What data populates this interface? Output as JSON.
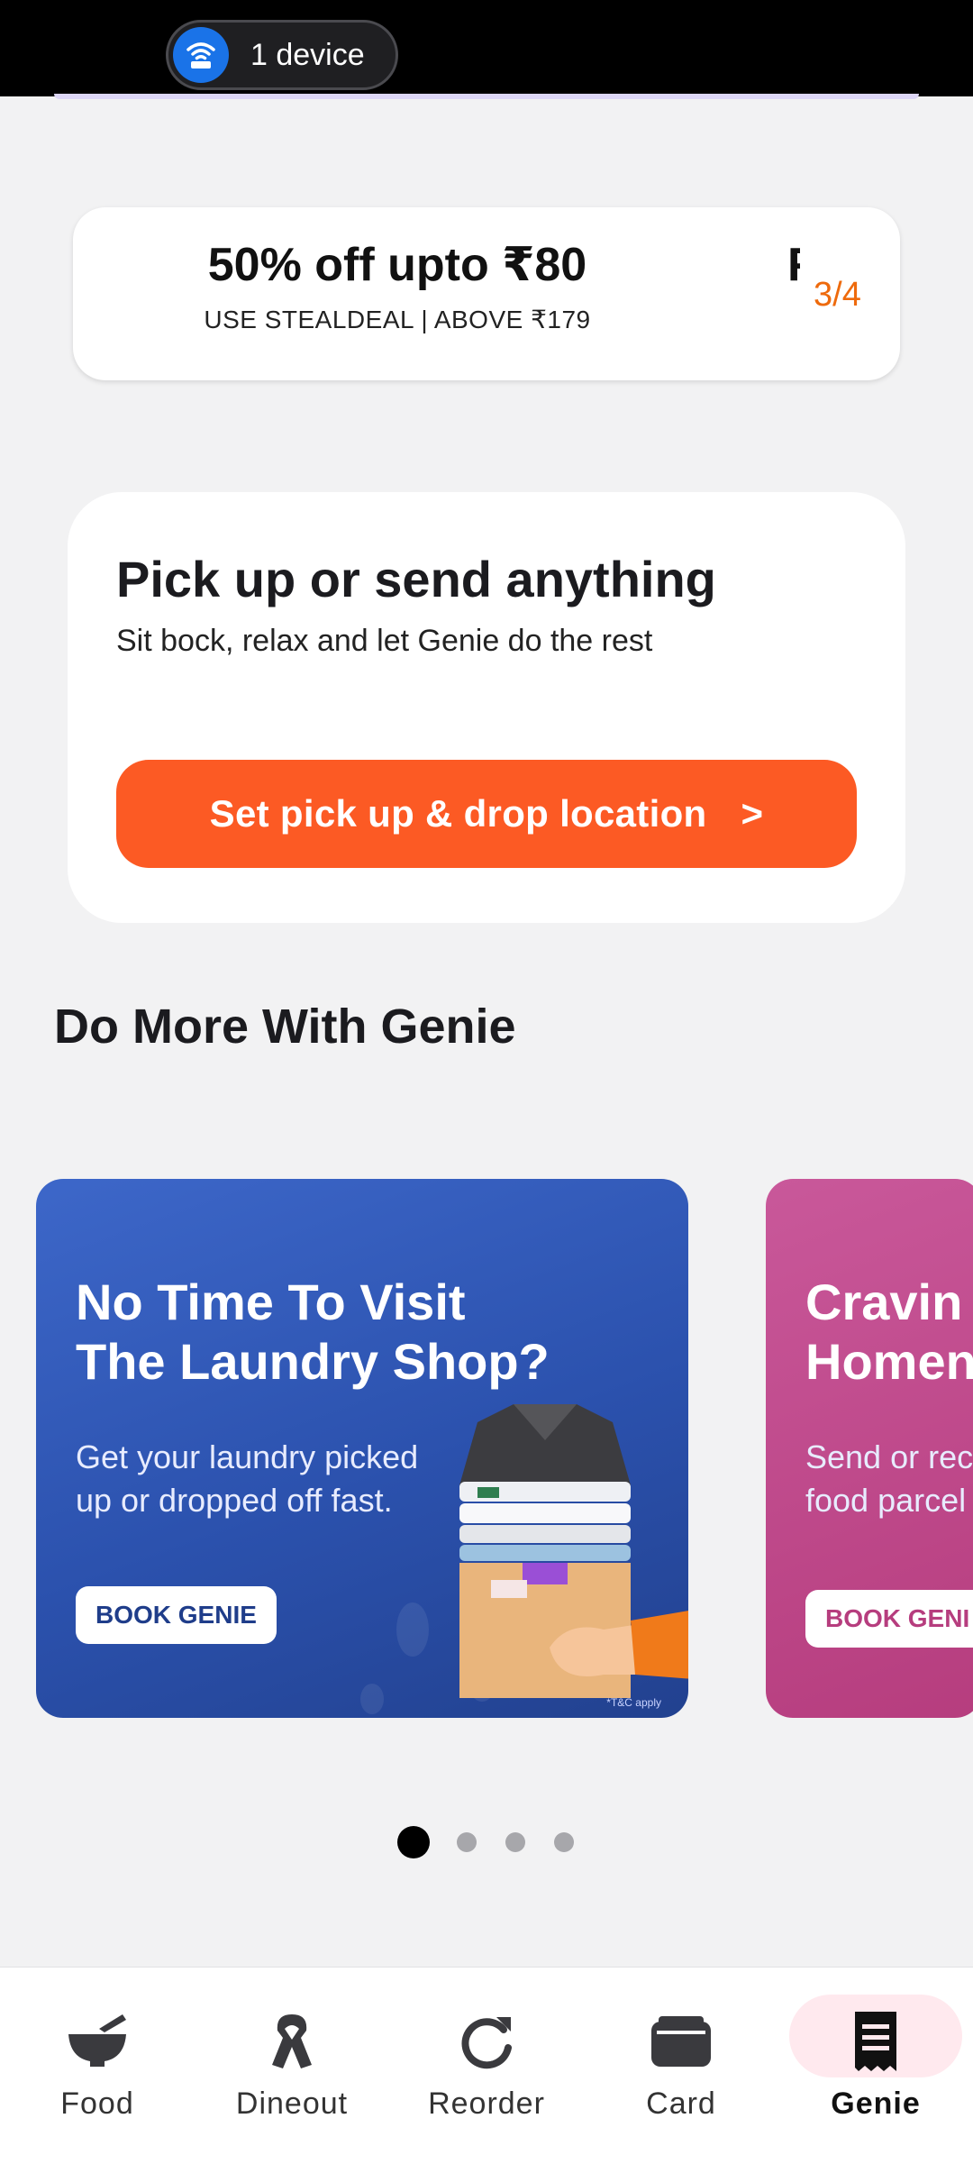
{
  "status_bar": {
    "device_label": "1 device"
  },
  "offer": {
    "title": "50% off upto ₹80",
    "subtitle": "USE STEALDEAL | ABOVE ₹179",
    "next_peek": "F",
    "counter": "3/4"
  },
  "genie_card": {
    "title": "Pick up or send anything",
    "subtitle": "Sit bock, relax and let Genie do the rest",
    "button_label": "Set pick up & drop location",
    "button_chevron": ">"
  },
  "section_title": "Do More With Genie",
  "banners": [
    {
      "heading_line1": "No Time To Visit",
      "heading_line2": "The Laundry Shop?",
      "desc_line1": "Get your laundry picked",
      "desc_line2": "up or dropped off fast.",
      "button": "BOOK GENIE",
      "note": "*T&C apply"
    },
    {
      "heading_line1": "Cravin",
      "heading_line2": "Homen",
      "desc_line1": "Send or rec",
      "desc_line2": "food parcel",
      "button": "BOOK GENI"
    }
  ],
  "carousel": {
    "total": 4,
    "active": 0
  },
  "bottom_nav": [
    {
      "label": "Food",
      "icon": "food-bowl-icon"
    },
    {
      "label": "Dineout",
      "icon": "dineout-ribbon-icon"
    },
    {
      "label": "Reorder",
      "icon": "reorder-refresh-icon"
    },
    {
      "label": "Card",
      "icon": "wallet-card-icon"
    },
    {
      "label": "Genie",
      "icon": "genie-receipt-icon",
      "active": true
    }
  ],
  "colors": {
    "accent": "#fc5a24",
    "offer_counter": "#ee6a0c",
    "active_nav_bg": "#ffe9ee"
  }
}
